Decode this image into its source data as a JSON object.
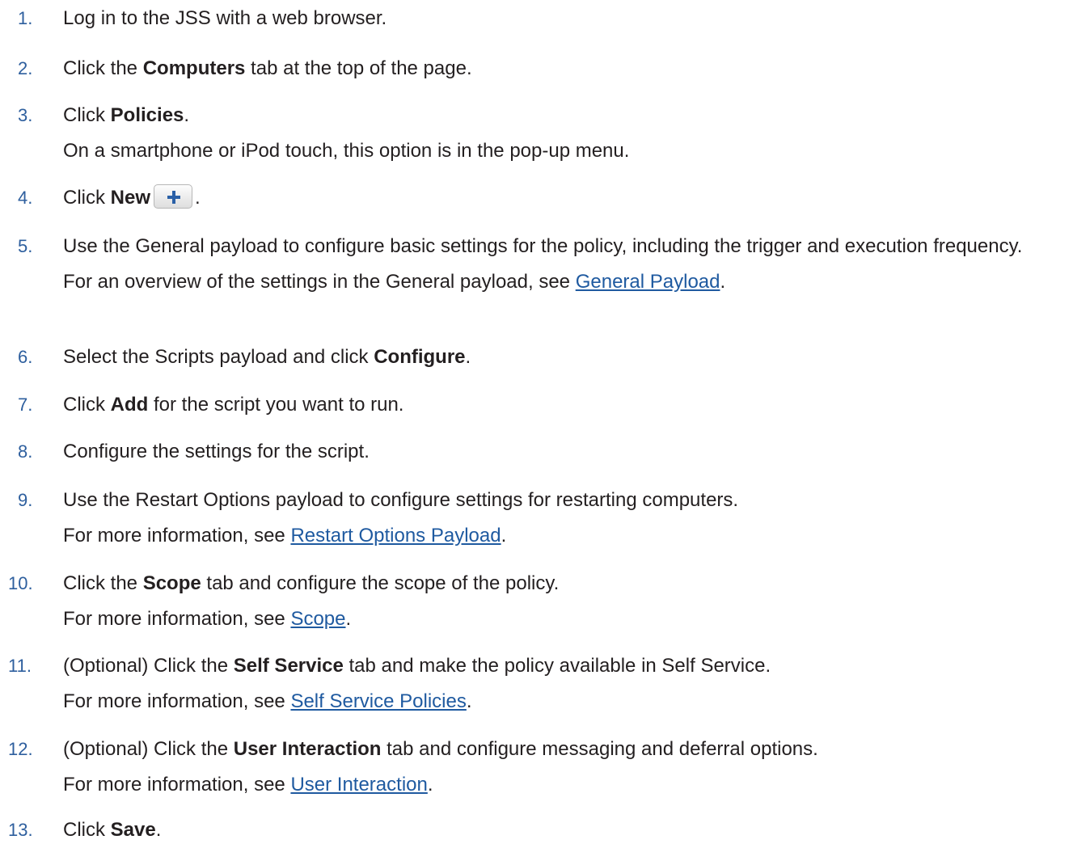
{
  "colors": {
    "text": "#231f20",
    "step_number": "#2e5f9e",
    "link": "#1f5aa0",
    "plus_icon": "#2a60a7"
  },
  "steps": [
    {
      "number": "1.",
      "parts": [
        "Log in to the JSS with a web browser."
      ]
    },
    {
      "number": "2.",
      "parts": [
        "Click the ",
        "Computers",
        " tab at the top of the page."
      ]
    },
    {
      "number": "3.",
      "parts": [
        "Click ",
        "Policies",
        "."
      ],
      "note": "On a smartphone or iPod touch, this option is in the pop-up menu."
    },
    {
      "number": "4.",
      "parts": [
        "Click ",
        "New",
        "."
      ],
      "button_icon": "plus-icon"
    },
    {
      "number": "5.",
      "parts": [
        "Use the General payload to configure basic settings for the policy, including the trigger and execution frequency."
      ],
      "note_prefix": "For an overview of the settings in the General payload, see ",
      "note_link": "General Payload",
      "note_suffix": "."
    },
    {
      "number": "6.",
      "parts": [
        "Select the Scripts payload and click ",
        "Configure",
        "."
      ]
    },
    {
      "number": "7.",
      "parts": [
        "Click ",
        "Add",
        " for the script you want to run."
      ]
    },
    {
      "number": "8.",
      "parts": [
        "Configure the settings for the script."
      ]
    },
    {
      "number": "9.",
      "parts": [
        "Use the Restart Options payload to configure settings for restarting computers."
      ],
      "note_prefix": "For more information, see ",
      "note_link": "Restart Options Payload",
      "note_suffix": "."
    },
    {
      "number": "10.",
      "parts": [
        "Click the ",
        "Scope",
        " tab and configure the scope of the policy."
      ],
      "note_prefix": "For more information, see ",
      "note_link": "Scope",
      "note_suffix": "."
    },
    {
      "number": "11.",
      "parts": [
        "(Optional) Click the ",
        "Self Service",
        " tab and make the policy available in Self Service."
      ],
      "note_prefix": "For more information, see ",
      "note_link": "Self Service Policies",
      "note_suffix": "."
    },
    {
      "number": "12.",
      "parts": [
        "(Optional) Click the ",
        "User Interaction",
        " tab and configure messaging and deferral options."
      ],
      "note_prefix": "For more information, see ",
      "note_link": "User Interaction",
      "note_suffix": "."
    },
    {
      "number": "13.",
      "parts": [
        "Click ",
        "Save",
        "."
      ]
    }
  ]
}
